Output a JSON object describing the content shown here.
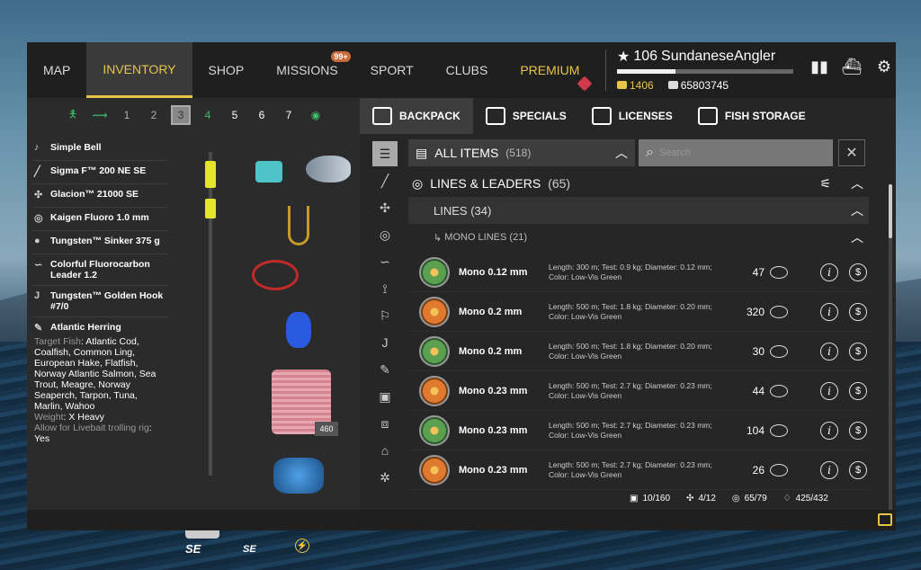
{
  "nav": {
    "items": [
      {
        "label": "MAP"
      },
      {
        "label": "INVENTORY",
        "active": true
      },
      {
        "label": "SHOP"
      },
      {
        "label": "MISSIONS",
        "badge": "99+"
      },
      {
        "label": "SPORT"
      },
      {
        "label": "CLUBS"
      },
      {
        "label": "PREMIUM"
      }
    ]
  },
  "player": {
    "level": "106",
    "name": "SundaneseAngler",
    "xp_fraction": 0.33,
    "gold": "1406",
    "silver": "65803745"
  },
  "slots": [
    "1",
    "2",
    "3",
    "4",
    "5",
    "6",
    "7"
  ],
  "gear": [
    {
      "label": "Simple Bell",
      "icon": "bell-icon"
    },
    {
      "label": "Sigma F™ 200 NE SE",
      "icon": "rod-icon"
    },
    {
      "label": "Glacion™ 21000 SE",
      "icon": "reel-icon"
    },
    {
      "label": "Kaigen Fluoro 1.0 mm",
      "icon": "line-icon"
    },
    {
      "label": "Tungsten™ Sinker 375 g",
      "icon": "sinker-icon"
    },
    {
      "label": "Colorful Fluorocarbon Leader 1.2",
      "icon": "leader-icon"
    },
    {
      "label": "Tungsten™ Golden Hook #7/0",
      "icon": "hook-icon"
    }
  ],
  "bait": {
    "title": "Atlantic Herring",
    "target_label": "Target Fish",
    "target_value": "Atlantic Cod, Coalfish, Common Ling, European Hake, Flatfish, Norway Atlantic Salmon, Sea Trout, Meagre, Norway Seaperch, Tarpon, Tuna, Marlin, Wahoo",
    "weight_label": "Weight",
    "weight_value": "X Heavy",
    "live_label": "Allow for Livebait trolling rig",
    "live_value": "Yes"
  },
  "line_count": "460",
  "rod_brand": "SE",
  "reel_brand": "SE",
  "tabs": [
    {
      "label": "BACKPACK",
      "active": true
    },
    {
      "label": "SPECIALS"
    },
    {
      "label": "LICENSES"
    },
    {
      "label": "FISH STORAGE"
    }
  ],
  "filters": {
    "all_items": "ALL ITEMS",
    "all_items_count": "(518)",
    "search_placeholder": "Search",
    "lines_leaders": "LINES & LEADERS",
    "lines_leaders_count": "(65)",
    "lines": "LINES",
    "lines_count": "(34)",
    "mono_lines": "MONO LINES",
    "mono_lines_count": "(21)"
  },
  "items": [
    {
      "name": "Mono 0.12 mm",
      "desc": "Length: 300 m; Test: 0.9 kg; Diameter: 0.12 mm; Color: Low-Vis Green",
      "qty": "47",
      "color": "green"
    },
    {
      "name": "Mono 0.2 mm",
      "desc": "Length: 500 m; Test: 1.8 kg; Diameter: 0.20 mm; Color: Low-Vis Green",
      "qty": "320",
      "color": "orange"
    },
    {
      "name": "Mono 0.2 mm",
      "desc": "Length: 500 m; Test: 1.8 kg; Diameter: 0.20 mm; Color: Low-Vis Green",
      "qty": "30",
      "color": "green"
    },
    {
      "name": "Mono 0.23 mm",
      "desc": "Length: 500 m; Test: 2.7 kg; Diameter: 0.23 mm; Color: Low-Vis Green",
      "qty": "44",
      "color": "orange"
    },
    {
      "name": "Mono 0.23 mm",
      "desc": "Length: 500 m; Test: 2.7 kg; Diameter: 0.23 mm; Color: Low-Vis Green",
      "qty": "104",
      "color": "green"
    },
    {
      "name": "Mono 0.23 mm",
      "desc": "Length: 500 m; Test: 2.7 kg; Diameter: 0.23 mm; Color: Low-Vis Green",
      "qty": "26",
      "color": "orange"
    }
  ],
  "stats": [
    {
      "icon": "backpack-icon",
      "value": "10/160"
    },
    {
      "icon": "rod-icon",
      "value": "4/12"
    },
    {
      "icon": "reel-icon",
      "value": "65/79"
    },
    {
      "icon": "lure-icon",
      "value": "425/432"
    }
  ],
  "colors": {
    "accent": "#e8c547",
    "active_slot": "#888888",
    "premium": "#e8c547"
  }
}
